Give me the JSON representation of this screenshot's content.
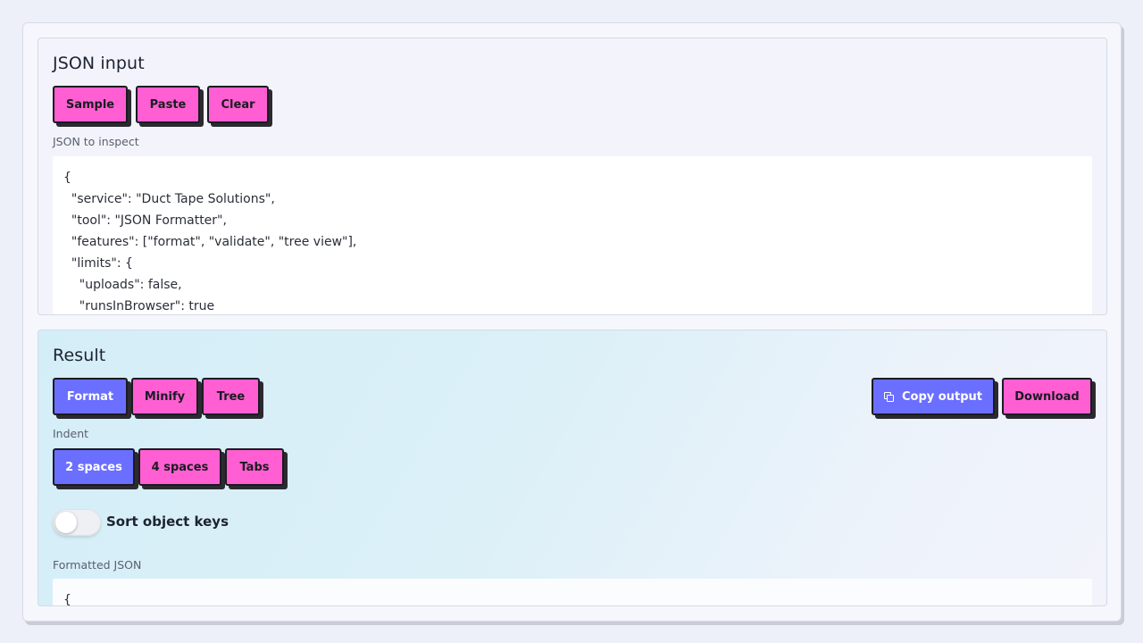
{
  "input": {
    "title": "JSON input",
    "buttons": {
      "sample": "Sample",
      "paste": "Paste",
      "clear": "Clear"
    },
    "field_label": "JSON to inspect",
    "value": "{\n  \"service\": \"Duct Tape Solutions\",\n  \"tool\": \"JSON Formatter\",\n  \"features\": [\"format\", \"validate\", \"tree view\"],\n  \"limits\": {\n    \"uploads\": false,\n    \"runsInBrowser\": true"
  },
  "result": {
    "title": "Result",
    "modes": {
      "format": "Format",
      "minify": "Minify",
      "tree": "Tree"
    },
    "active_mode": "Format",
    "actions": {
      "copy": "Copy output",
      "download": "Download"
    },
    "indent_label": "Indent",
    "indent": {
      "two": "2 spaces",
      "four": "4 spaces",
      "tabs": "Tabs"
    },
    "active_indent": "2 spaces",
    "sort_keys_label": "Sort object keys",
    "sort_keys_enabled": false,
    "output_label": "Formatted JSON",
    "output_value": "{"
  },
  "colors": {
    "accent_active": "#6b6fff",
    "accent_pink": "#ff5fd2"
  },
  "icons": {
    "copy": "copy-icon"
  }
}
